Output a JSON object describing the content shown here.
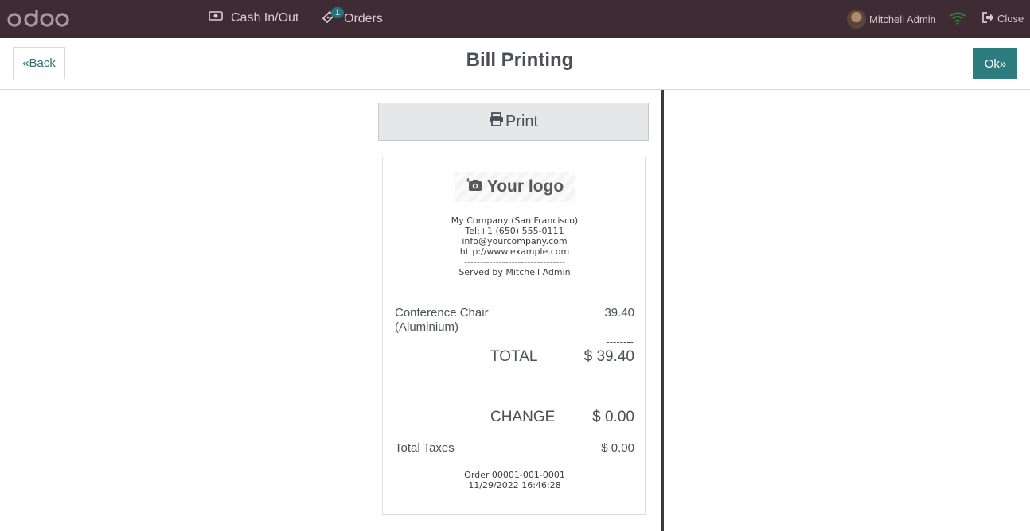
{
  "navbar": {
    "logo_text": "odoo",
    "cash_label": "Cash In/Out",
    "orders_label": "Orders",
    "orders_badge": "1",
    "user_name": "Mitchell Admin",
    "close_label": "Close",
    "colors": {
      "background": "#3f2b34",
      "badge": "#24737a",
      "wifi": "#2e8b2e"
    }
  },
  "header": {
    "back_label": "Back",
    "title": "Bill Printing",
    "ok_label": "Ok",
    "colors": {
      "ok_button": "#2d7c80",
      "back_text": "#2f6f78"
    }
  },
  "panel": {
    "print_label": "Print"
  },
  "receipt": {
    "logo_label": "Your logo",
    "company_lines": [
      "My Company (San Francisco)",
      "Tel:+1 (650) 555-0111",
      "info@yourcompany.com",
      "http://www.example.com",
      "--------------------------------",
      "Served by Mitchell Admin"
    ],
    "lines": [
      {
        "product": "Conference Chair (Aluminium)",
        "price": "39.40"
      }
    ],
    "dashes": "--------",
    "total_label": "TOTAL",
    "total_value": "$ 39.40",
    "change_label": "CHANGE",
    "change_value": "$ 0.00",
    "taxes_label": "Total Taxes",
    "taxes_value": "$ 0.00",
    "order_ref": "Order 00001-001-0001",
    "order_datetime": "11/29/2022 16:46:28"
  },
  "icons": {
    "cash": "money-icon",
    "orders": "ticket-icon",
    "wifi": "wifi-icon",
    "close": "sign-out-icon",
    "print": "printer-icon",
    "camera": "camera-icon",
    "back": "double-chevron-left-icon",
    "ok": "double-chevron-right-icon"
  }
}
